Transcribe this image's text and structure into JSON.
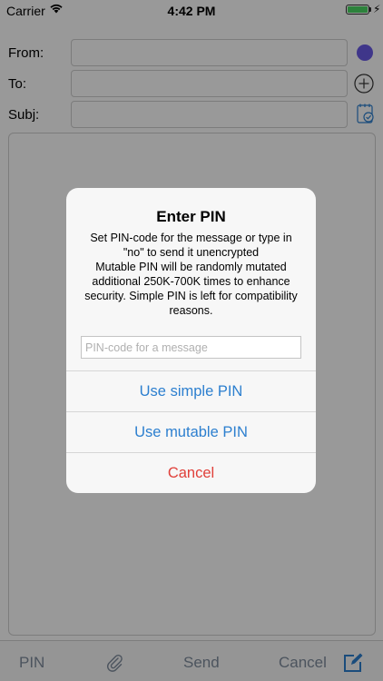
{
  "status_bar": {
    "carrier": "Carrier",
    "time": "4:42 PM",
    "wifi_icon": "wifi-icon",
    "battery_icon": "battery-icon",
    "charging_icon": "charging-bolt-icon"
  },
  "compose": {
    "from_label": "From:",
    "to_label": "To:",
    "subject_label": "Subj:",
    "from_value": "",
    "to_value": "",
    "subject_value": "",
    "from_dot_color": "#6a5ae6"
  },
  "toolbar": {
    "pin_label": "PIN",
    "send_label": "Send",
    "cancel_label": "Cancel",
    "attach_icon": "paperclip-icon",
    "compose_icon": "compose-icon"
  },
  "alert": {
    "title": "Enter PIN",
    "message": "Set PIN-code for the message or type in \"no\" to send it unencrypted\nMutable PIN will be randomly mutated additional 250K-700K times to enhance security. Simple PIN is left for compatibility reasons.",
    "input_placeholder": "PIN-code for a message",
    "input_value": "",
    "simple_button": "Use simple PIN",
    "mutable_button": "Use mutable PIN",
    "cancel_button": "Cancel"
  },
  "colors": {
    "accent": "#2c7fcf",
    "destructive": "#e0403a",
    "toolbar_text": "#7f8c9d"
  }
}
